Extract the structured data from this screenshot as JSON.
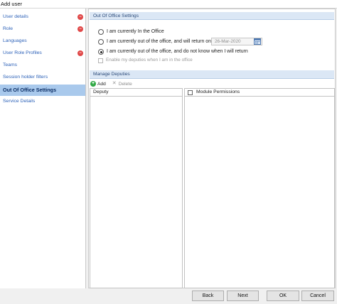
{
  "window": {
    "title": "Add user"
  },
  "sidebar": {
    "items": [
      {
        "label": "User details",
        "error": true
      },
      {
        "label": "Role",
        "error": true
      },
      {
        "label": "Languages",
        "error": false
      },
      {
        "label": "User Role Profiles",
        "error": true
      },
      {
        "label": "Teams",
        "error": false
      },
      {
        "label": "Session holder filters",
        "error": false
      },
      {
        "label": "Out Of Office Settings",
        "error": false,
        "selected": true
      },
      {
        "label": "Service Details",
        "error": false
      }
    ],
    "error_icon": "error-badge-icon"
  },
  "out_of_office": {
    "section_title": "Out Of Office Settings",
    "option_in_office": "I am currently In the Office",
    "option_return_on": "I am currently out of the office, and will return on",
    "return_date": "26-Mar-2020",
    "option_unknown": "I am currently out of the office, and do not know when I will return",
    "selected_option": "unknown",
    "enable_deputies_label": "Enable my deputies when I am in the office",
    "enable_deputies_checked": false
  },
  "deputies": {
    "section_title": "Manage Deputies",
    "add_label": "Add",
    "delete_label": "Delete",
    "deputy_column": "Deputy",
    "permissions_column": "Module Permissions",
    "rows": []
  },
  "footer": {
    "back_label": "Back",
    "next_label": "Next",
    "ok_label": "OK",
    "cancel_label": "Cancel"
  },
  "colors": {
    "link": "#2c61b8",
    "selected_bg": "#a9c9ec",
    "section_header_bg": "#dbe7f5",
    "error_red": "#e04848",
    "add_green": "#2fa843"
  }
}
